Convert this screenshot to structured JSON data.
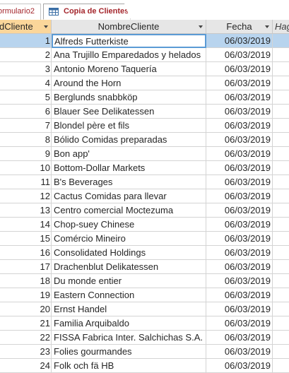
{
  "tabs": [
    {
      "label": "ormulario2"
    },
    {
      "label": "Copia de Clientes"
    }
  ],
  "columns": [
    {
      "label": "dCliente"
    },
    {
      "label": "NombreCliente"
    },
    {
      "label": "Fecha"
    },
    {
      "label": "Hag"
    }
  ],
  "rows": [
    {
      "id": "1",
      "name": "Alfreds Futterkiste",
      "date": "06/03/2019"
    },
    {
      "id": "2",
      "name": "Ana Trujillo Emparedados y helados",
      "date": "06/03/2019"
    },
    {
      "id": "3",
      "name": "Antonio Moreno Taquería",
      "date": "06/03/2019"
    },
    {
      "id": "4",
      "name": "Around the Horn",
      "date": "06/03/2019"
    },
    {
      "id": "5",
      "name": "Berglunds snabbköp",
      "date": "06/03/2019"
    },
    {
      "id": "6",
      "name": "Blauer See Delikatessen",
      "date": "06/03/2019"
    },
    {
      "id": "7",
      "name": "Blondel père et fils",
      "date": "06/03/2019"
    },
    {
      "id": "8",
      "name": "Bólido Comidas preparadas",
      "date": "06/03/2019"
    },
    {
      "id": "9",
      "name": "Bon app'",
      "date": "06/03/2019"
    },
    {
      "id": "10",
      "name": "Bottom-Dollar Markets",
      "date": "06/03/2019"
    },
    {
      "id": "11",
      "name": "B's Beverages",
      "date": "06/03/2019"
    },
    {
      "id": "12",
      "name": "Cactus Comidas para llevar",
      "date": "06/03/2019"
    },
    {
      "id": "13",
      "name": "Centro comercial Moctezuma",
      "date": "06/03/2019"
    },
    {
      "id": "14",
      "name": "Chop-suey Chinese",
      "date": "06/03/2019"
    },
    {
      "id": "15",
      "name": "Comércio Mineiro",
      "date": "06/03/2019"
    },
    {
      "id": "16",
      "name": "Consolidated Holdings",
      "date": "06/03/2019"
    },
    {
      "id": "17",
      "name": "Drachenblut Delikatessen",
      "date": "06/03/2019"
    },
    {
      "id": "18",
      "name": "Du monde entier",
      "date": "06/03/2019"
    },
    {
      "id": "19",
      "name": "Eastern Connection",
      "date": "06/03/2019"
    },
    {
      "id": "20",
      "name": "Ernst Handel",
      "date": "06/03/2019"
    },
    {
      "id": "21",
      "name": "Familia Arquibaldo",
      "date": "06/03/2019"
    },
    {
      "id": "22",
      "name": "FISSA Fabrica Inter. Salchichas S.A.",
      "date": "06/03/2019"
    },
    {
      "id": "23",
      "name": "Folies gourmandes",
      "date": "06/03/2019"
    },
    {
      "id": "24",
      "name": "Folk och fä HB",
      "date": "06/03/2019"
    }
  ],
  "selected_row": 0,
  "colors": {
    "accent_tab_text": "#a4262c",
    "header_highlight": "#fbd69a",
    "selection": "#b8d4ee"
  },
  "icons": {
    "tab": "table-datasheet-icon",
    "sort": "dropdown-arrow-icon"
  }
}
